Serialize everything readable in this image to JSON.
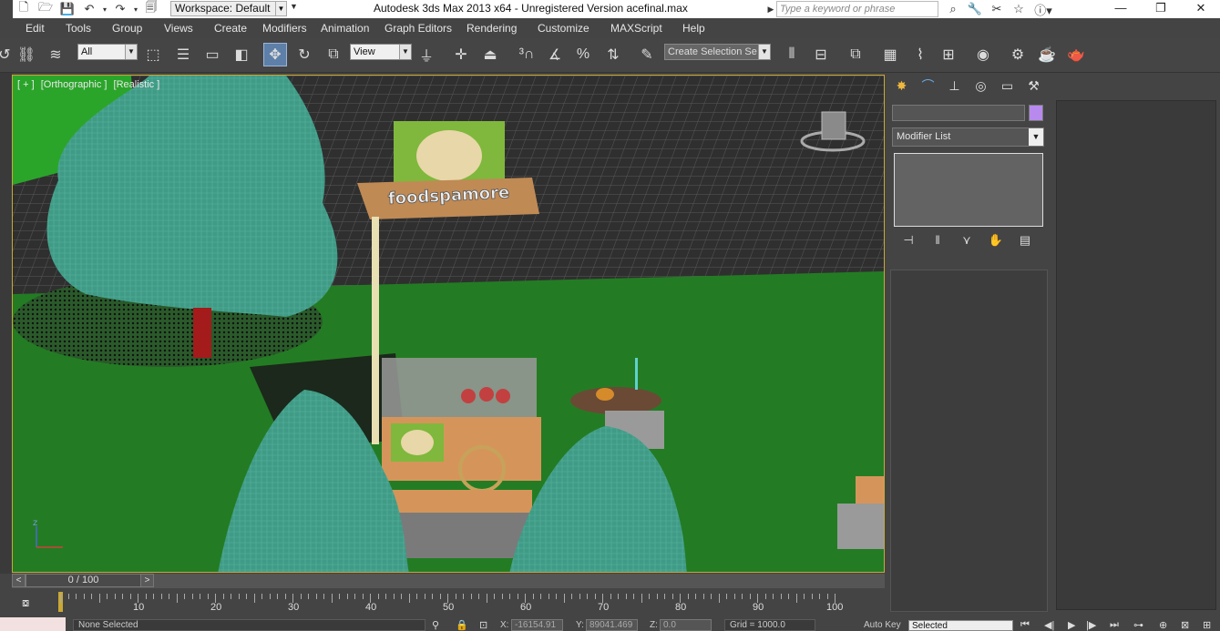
{
  "titlebar": {
    "workspace": "Workspace: Default",
    "title": "Autodesk 3ds Max  2013 x64   - Unregistered Version     acefinal.max",
    "search_placeholder": "Type a keyword or phrase"
  },
  "menu": [
    "Edit",
    "Tools",
    "Group",
    "Views",
    "Create",
    "Modifiers",
    "Animation",
    "Graph Editors",
    "Rendering",
    "Customize",
    "MAXScript",
    "Help"
  ],
  "toolbar": {
    "selection_filter": "All",
    "reference_coord": "View",
    "named_selection_placeholder": "Create Selection Se"
  },
  "viewport": {
    "label_plus": "[ + ]",
    "label_view": "[Orthographic ]",
    "label_shading": "[Realistic ]",
    "sign_text": "foodspamore",
    "axis_label": "z"
  },
  "command_panel": {
    "modifier_list": "Modifier List"
  },
  "timeslider": {
    "frame": "0 / 100",
    "prev": "<",
    "next": ">"
  },
  "trackbar": {
    "ticks": [
      "10",
      "20",
      "30",
      "40",
      "50",
      "60",
      "70",
      "80",
      "90",
      "100"
    ]
  },
  "status": {
    "selection": "None Selected",
    "x_label": "X:",
    "x_value": "-16154.91",
    "y_label": "Y:",
    "y_value": "89041.469",
    "z_label": "Z:",
    "z_value": "0.0",
    "grid": "Grid = 1000.0",
    "autokey": "Auto Key",
    "key_filter": "Selected"
  }
}
